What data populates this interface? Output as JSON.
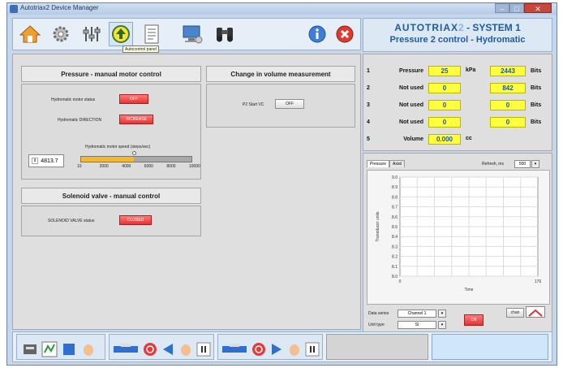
{
  "window": {
    "title": "Autotriax2 Device Manager"
  },
  "toolbar": {
    "tooltip": "Autocontrol panel",
    "icons": [
      "home-icon",
      "gear-icon",
      "sliders-icon",
      "up-arrow-icon",
      "document-icon",
      "computer-icon",
      "binoculars-icon",
      "info-icon",
      "close-icon"
    ]
  },
  "brand": {
    "logo": "AUTOTRIAX",
    "logo_sub": "2",
    "system": "- SYSTEM 1",
    "subtitle": "Pressure 2 control - Hydromatic"
  },
  "pressure_panel": {
    "title": "Pressure - manual motor control",
    "status_label": "Hydromatic motor status",
    "status_value": "OFF",
    "direction_label": "Hydromatic DIRECTION",
    "direction_value": "INCREASE",
    "speed_label": "Hydromatic motor speed (steps/sec)",
    "speed_value": "4813.7",
    "speed_fraction": 0.48,
    "scale": [
      "10",
      "2000",
      "4000",
      "6000",
      "8000",
      "10000"
    ]
  },
  "solenoid_panel": {
    "title": "Solenoid valve - manual control",
    "status_label": "SOLENOID VALVE status",
    "status_value": "CLOSED"
  },
  "volume_panel": {
    "title": "Change in volume measurement",
    "label": "P2 Start VC",
    "button": "OFF"
  },
  "readings": [
    {
      "num": "1",
      "name": "Pressure",
      "value": "25",
      "unit": "kPa",
      "bits": "2443",
      "bits_unit": "Bits"
    },
    {
      "num": "2",
      "name": "Not used",
      "value": "0",
      "unit": "",
      "bits": "842",
      "bits_unit": "Bits"
    },
    {
      "num": "3",
      "name": "Not used",
      "value": "0",
      "unit": "",
      "bits": "0",
      "bits_unit": "Bits"
    },
    {
      "num": "4",
      "name": "Not used",
      "value": "0",
      "unit": "",
      "bits": "0",
      "bits_unit": "Bits"
    },
    {
      "num": "5",
      "name": "Volume",
      "value": "0.000",
      "unit": "cc",
      "bits": "",
      "bits_unit": ""
    }
  ],
  "graph": {
    "tabs": [
      "Pressure",
      "Axial"
    ],
    "refresh_label": "Refresh, ms",
    "refresh_value": "500",
    "data_series_label": "Data series",
    "data_series_value": "Channel 1",
    "unit_type_label": "Unit type",
    "unit_type_value": "SI",
    "off_button": "Off",
    "chan_button": "chan"
  },
  "chart_data": {
    "type": "line",
    "title": "",
    "xlabel": "Time",
    "ylabel": "Transducer units",
    "xlim": [
      0,
      176
    ],
    "ylim": [
      8.0,
      9.0
    ],
    "x_ticks": [
      "0",
      "176"
    ],
    "y_ticks": [
      "9.0",
      "8.9",
      "8.8",
      "8.7",
      "8.6",
      "8.5",
      "8.4",
      "8.3",
      "8.2",
      "8.1",
      "8.0"
    ],
    "grid": true,
    "series": []
  },
  "statusbar": {
    "icons": [
      "device-icon",
      "network-icon",
      "stop-icon",
      "hand-icon",
      "actuator-icon",
      "power-icon",
      "left-arrow-icon",
      "hand-icon",
      "pause-icon",
      "actuator-icon",
      "power-icon",
      "right-arrow-icon",
      "hand-icon",
      "pause-icon"
    ]
  }
}
